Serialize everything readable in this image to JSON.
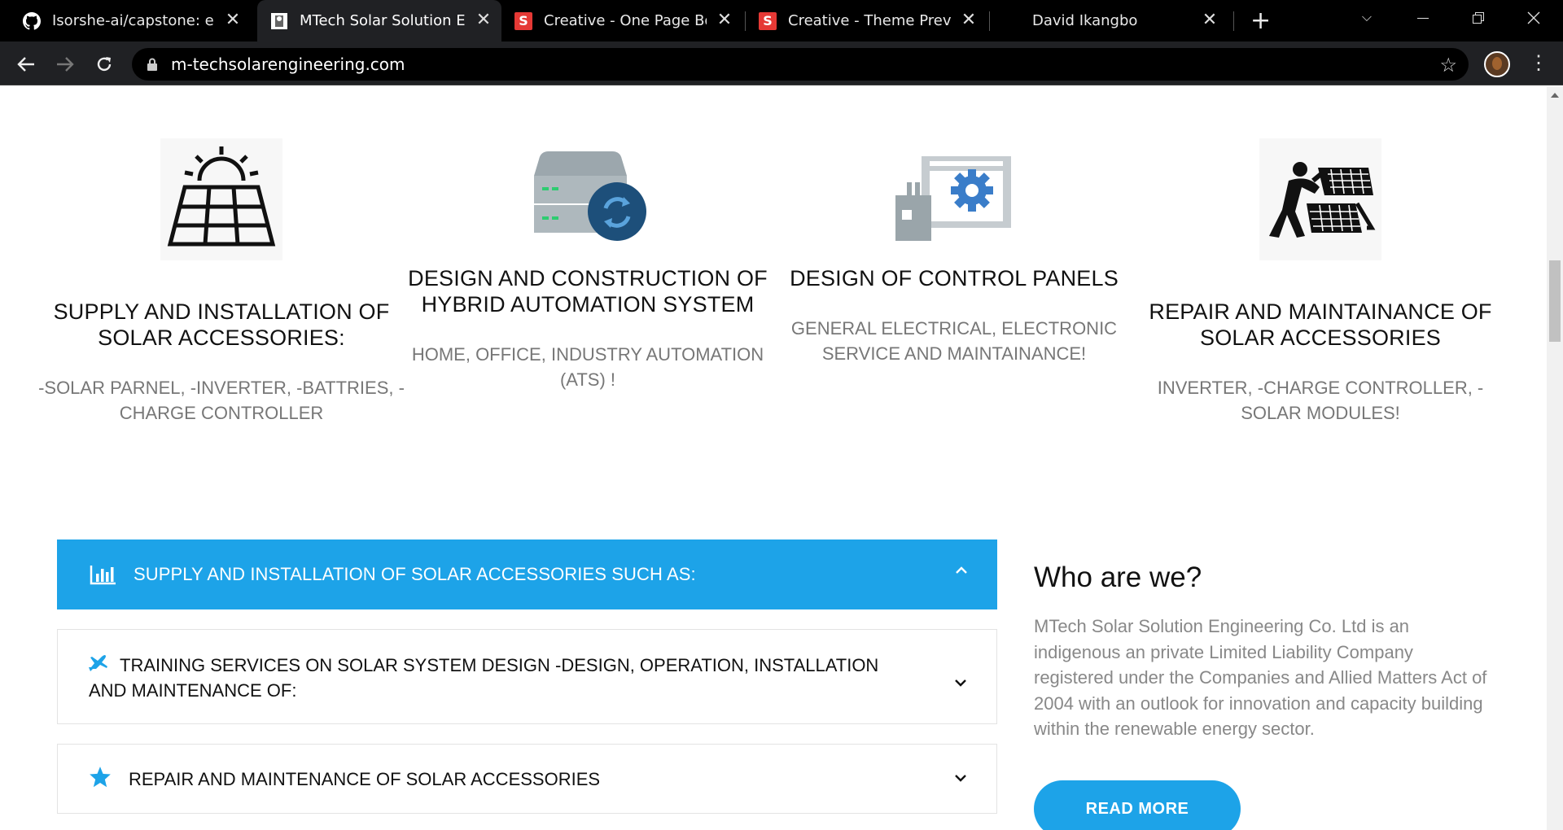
{
  "browser": {
    "tabs": [
      {
        "title": "Isorshe-ai/capstone: eHA",
        "icon": "github-icon"
      },
      {
        "title": "MTech Solar Solution Engi",
        "icon": "site-favicon",
        "active": true
      },
      {
        "title": "Creative - One Page Boot",
        "icon": "s-favicon"
      },
      {
        "title": "Creative - Theme Preview",
        "icon": "s-favicon"
      },
      {
        "title": "David Ikangbo",
        "icon": ""
      }
    ],
    "new_tab": "+",
    "url": "m-techsolarengineering.com"
  },
  "services": [
    {
      "title": "SUPPLY AND INSTALLATION OF SOLAR ACCESSORIES:",
      "desc": "-SOLAR PARNEL, -INVERTER, -BATTRIES, -CHARGE CONTROLLER",
      "icon": "solar-panel-icon"
    },
    {
      "title": "DESIGN AND CONSTRUCTION OF HYBRID AUTOMATION SYSTEM",
      "desc": "HOME, OFFICE, INDUSTRY AUTOMATION (ATS) !",
      "icon": "server-sync-icon"
    },
    {
      "title": "DESIGN OF CONTROL PANELS",
      "desc": "GENERAL ELECTRICAL, ELECTRONIC SERVICE AND MAINTAINANCE!",
      "icon": "control-panel-icon"
    },
    {
      "title": "REPAIR AND MAINTAINANCE OF SOLAR ACCESSORIES",
      "desc": "INVERTER, -CHARGE CONTROLLER, -SOLAR MODULES!",
      "icon": "solar-repair-icon"
    }
  ],
  "accordion": [
    {
      "label": "SUPPLY AND INSTALLATION OF SOLAR ACCESSORIES SUCH AS:",
      "icon": "bar-chart-icon",
      "expanded": true
    },
    {
      "label": "TRAINING SERVICES ON SOLAR SYSTEM DESIGN -DESIGN, OPERATION, INSTALLATION AND MAINTENANCE OF:",
      "icon": "plane-icon",
      "expanded": false
    },
    {
      "label": "REPAIR AND MAINTENANCE OF SOLAR ACCESSORIES",
      "icon": "star-icon",
      "expanded": false
    }
  ],
  "about": {
    "heading": "Who are we?",
    "body": "MTech Solar Solution Engineering Co. Ltd is an indigenous an private Limited Liability Company registered under the Companies and Allied Matters Act of 2004 with an outlook for innovation and capacity building within the renewable energy sector.",
    "button": "READ MORE"
  },
  "colors": {
    "accent": "#1da3e8",
    "chrome": "#202124"
  }
}
